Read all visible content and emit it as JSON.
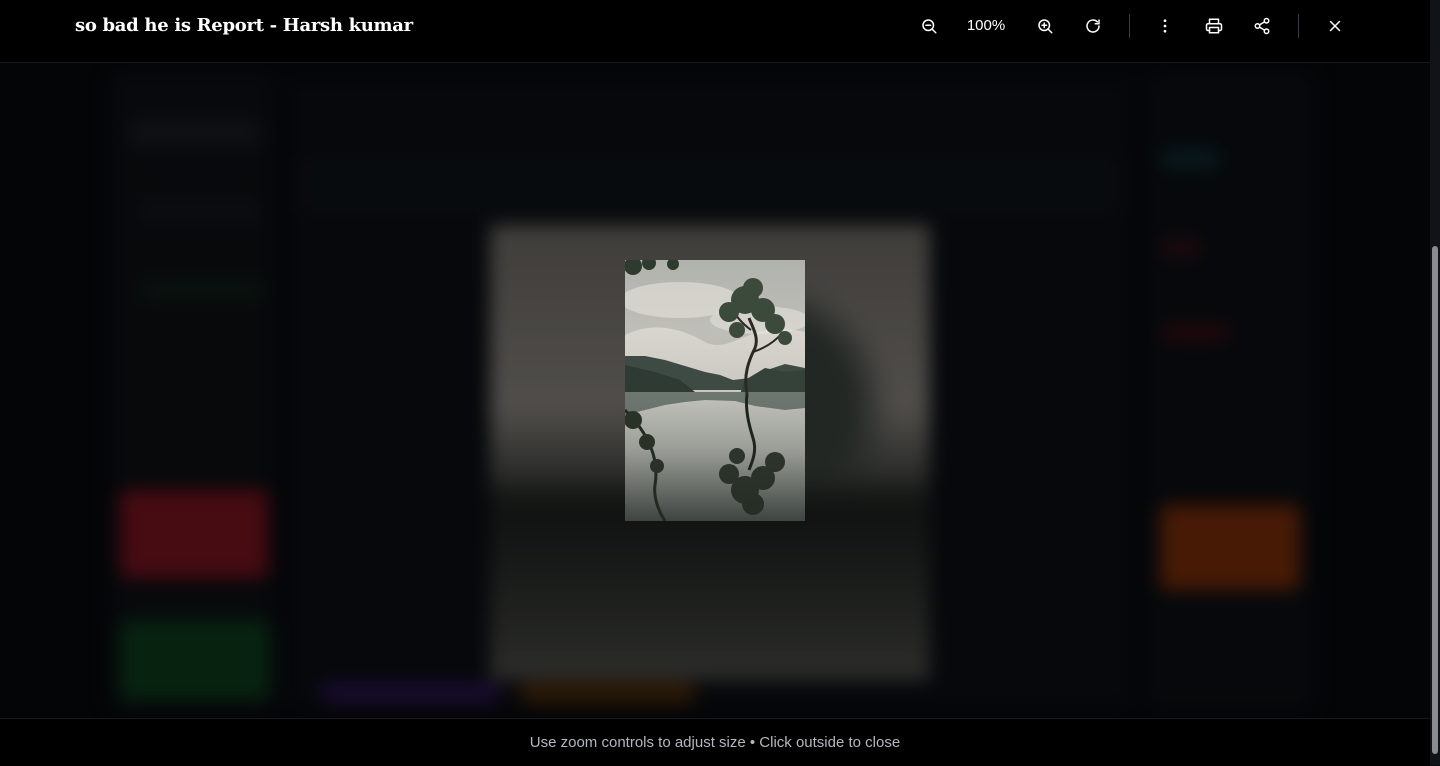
{
  "viewer": {
    "title": "so bad he is Report - Harsh kumar",
    "zoom": "100%",
    "hint": "Use zoom controls to adjust size • Click outside to close",
    "image_alt": "Lone tree growing in a lake reflecting on calm water with mountains and cloudy sky"
  },
  "toolbar": [
    {
      "name": "zoom-out-button",
      "icon": "zoom-out-icon"
    },
    {
      "name": "zoom-in-button",
      "icon": "zoom-in-icon"
    },
    {
      "name": "reset-rotate-button",
      "icon": "refresh-icon"
    },
    {
      "name": "more-options-button",
      "icon": "more-vertical-icon"
    },
    {
      "name": "print-button",
      "icon": "print-icon"
    },
    {
      "name": "share-button",
      "icon": "share-icon"
    },
    {
      "name": "close-button",
      "icon": "close-icon"
    }
  ],
  "colors": {
    "overlay": "#000000",
    "text": "#ffffff",
    "hint": "#b4b7bd",
    "background_red": "#7a1320",
    "background_green": "#0d3d1d",
    "background_orange": "#7a2e0b",
    "background_purple": "#2a1550"
  }
}
